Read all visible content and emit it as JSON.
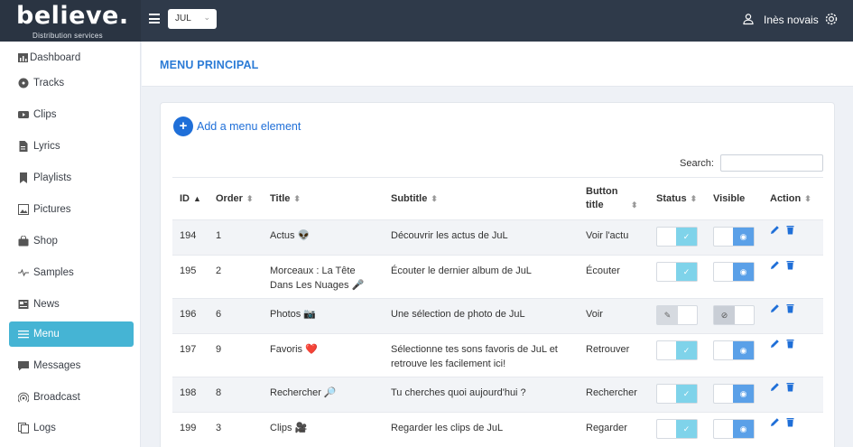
{
  "brand": {
    "name": "believe.",
    "tagline": "Distribution services"
  },
  "topbar": {
    "artist_selected": "JUL",
    "user_name": "Inès novais"
  },
  "sidebar": {
    "items": [
      {
        "label": "Dashboard",
        "icon": "chart-icon"
      },
      {
        "label": "Tracks",
        "icon": "disc-icon"
      },
      {
        "label": "Clips",
        "icon": "video-icon"
      },
      {
        "label": "Lyrics",
        "icon": "document-icon"
      },
      {
        "label": "Playlists",
        "icon": "list-icon"
      },
      {
        "label": "Pictures",
        "icon": "image-icon"
      },
      {
        "label": "Shop",
        "icon": "bag-icon"
      },
      {
        "label": "Samples",
        "icon": "waveform-icon"
      },
      {
        "label": "News",
        "icon": "newspaper-icon"
      },
      {
        "label": "Menu",
        "icon": "menu-icon",
        "active": true
      },
      {
        "label": "Messages",
        "icon": "message-icon"
      },
      {
        "label": "Broadcast",
        "icon": "broadcast-icon"
      },
      {
        "label": "Logs",
        "icon": "logs-icon"
      }
    ]
  },
  "page": {
    "title": "MENU PRINCIPAL"
  },
  "card": {
    "add_label": "Add a menu element",
    "search_label": "Search:",
    "search_value": "",
    "columns": [
      "ID",
      "Order",
      "Title",
      "Subtitle",
      "Button title",
      "Status",
      "Visible",
      "Action"
    ],
    "rows": [
      {
        "id": "194",
        "order": "1",
        "title": "Actus 👽",
        "subtitle": "Découvrir les actus de JuL",
        "button": "Voir l'actu",
        "status": true,
        "visible": true
      },
      {
        "id": "195",
        "order": "2",
        "title": "Morceaux : La Tête Dans Les Nuages 🎤",
        "subtitle": "Écouter le dernier album de JuL",
        "button": "Écouter",
        "status": true,
        "visible": true
      },
      {
        "id": "196",
        "order": "6",
        "title": "Photos 📷",
        "subtitle": "Une sélection de photo de JuL",
        "button": "Voir",
        "status": false,
        "visible": false
      },
      {
        "id": "197",
        "order": "9",
        "title": "Favoris ❤️",
        "subtitle": "Sélectionne tes sons favoris de JuL et retrouve les facilement ici!",
        "button": "Retrouver",
        "status": true,
        "visible": true
      },
      {
        "id": "198",
        "order": "8",
        "title": "Rechercher 🔎",
        "subtitle": "Tu cherches quoi aujourd'hui ?",
        "button": "Rechercher",
        "status": true,
        "visible": true
      },
      {
        "id": "199",
        "order": "3",
        "title": "Clips 🎥",
        "subtitle": "Regarder les clips de JuL",
        "button": "Regarder",
        "status": true,
        "visible": true
      }
    ]
  },
  "colors": {
    "accent": "#45b4d4",
    "link": "#1f6fd8",
    "topbar": "#2f3a4a",
    "toggle_on": "#7fd3ea",
    "visible_on": "#5aa0e8"
  }
}
